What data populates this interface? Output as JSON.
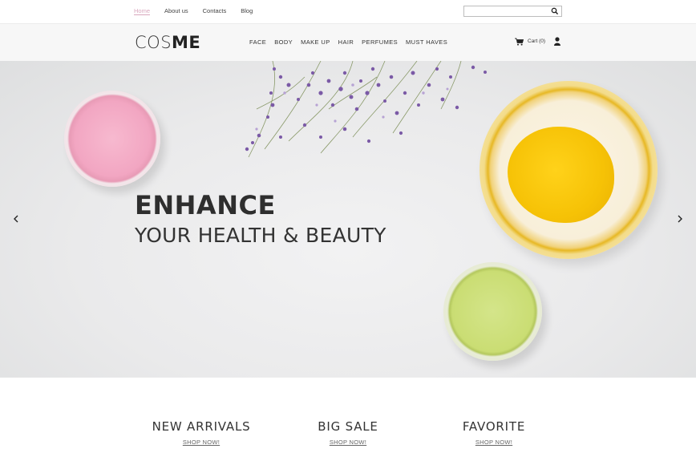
{
  "topbar": {
    "links": [
      {
        "label": "Home",
        "active": true
      },
      {
        "label": "About us"
      },
      {
        "label": "Contacts"
      },
      {
        "label": "Blog"
      }
    ],
    "search": {
      "placeholder": "",
      "value": "",
      "icon": "search-icon"
    }
  },
  "header": {
    "logo_light": "COS",
    "logo_bold": "ME",
    "nav": [
      "FACE",
      "BODY",
      "MAKE UP",
      "HAIR",
      "PERFUMES",
      "MUST HAVES"
    ],
    "cart_label": "Cart (0)",
    "cart_icon": "cart-icon",
    "user_icon": "user-icon"
  },
  "hero": {
    "title": "ENHANCE",
    "subtitle": "YOUR HEALTH & BEAUTY",
    "prev_icon": "chevron-left-icon",
    "next_icon": "chevron-right-icon"
  },
  "features": [
    {
      "title": "NEW ARRIVALS",
      "link": "SHOP NOW!"
    },
    {
      "title": "BIG SALE",
      "link": "SHOP NOW!"
    },
    {
      "title": "FAVORITE",
      "link": "SHOP NOW!"
    }
  ],
  "colors": {
    "accent_active": "#d9a7bd",
    "header_bg": "#f7f7f7",
    "text_dark": "#2e2e2e"
  }
}
